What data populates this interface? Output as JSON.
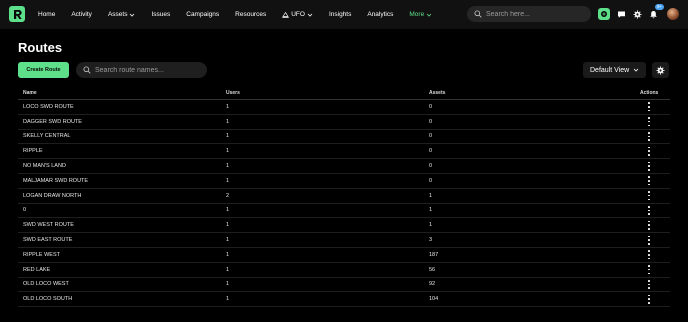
{
  "nav": {
    "items": [
      {
        "label": "Home"
      },
      {
        "label": "Activity"
      },
      {
        "label": "Assets"
      },
      {
        "label": "Issues"
      },
      {
        "label": "Campaigns"
      },
      {
        "label": "Resources"
      },
      {
        "label": "UFO"
      },
      {
        "label": "Insights"
      },
      {
        "label": "Analytics"
      },
      {
        "label": "More"
      }
    ],
    "search_placeholder": "Search here...",
    "notification_count": "9+"
  },
  "page": {
    "title": "Routes",
    "create_label": "Create Route",
    "search_placeholder": "Search route names...",
    "view_label": "Default View"
  },
  "table": {
    "columns": [
      "Name",
      "Users",
      "Assets",
      "Actions"
    ],
    "rows": [
      {
        "name": "LOCO SWD ROUTE",
        "users": "1",
        "assets": "0"
      },
      {
        "name": "DAGGER SWD ROUTE",
        "users": "1",
        "assets": "0"
      },
      {
        "name": "SKELLY CENTRAL",
        "users": "1",
        "assets": "0"
      },
      {
        "name": "RIPPLE",
        "users": "1",
        "assets": "0"
      },
      {
        "name": "NO MAN'S LAND",
        "users": "1",
        "assets": "0"
      },
      {
        "name": "MALJAMAR SWD ROUTE",
        "users": "1",
        "assets": "0"
      },
      {
        "name": "LOGAN DRAW NORTH",
        "users": "2",
        "assets": "1"
      },
      {
        "name": "0",
        "users": "1",
        "assets": "1"
      },
      {
        "name": "SWD WEST ROUTE",
        "users": "1",
        "assets": "1"
      },
      {
        "name": "SWD EAST ROUTE",
        "users": "1",
        "assets": "3"
      },
      {
        "name": "RIPPLE WEST",
        "users": "1",
        "assets": "187"
      },
      {
        "name": "RED LAKE",
        "users": "1",
        "assets": "56"
      },
      {
        "name": "OLD LOCO WEST",
        "users": "1",
        "assets": "92"
      },
      {
        "name": "OLD LOCO SOUTH",
        "users": "1",
        "assets": "104"
      }
    ]
  },
  "colors": {
    "accent": "#5ee08a",
    "background": "#000000",
    "badge": "#4aa3f0"
  }
}
